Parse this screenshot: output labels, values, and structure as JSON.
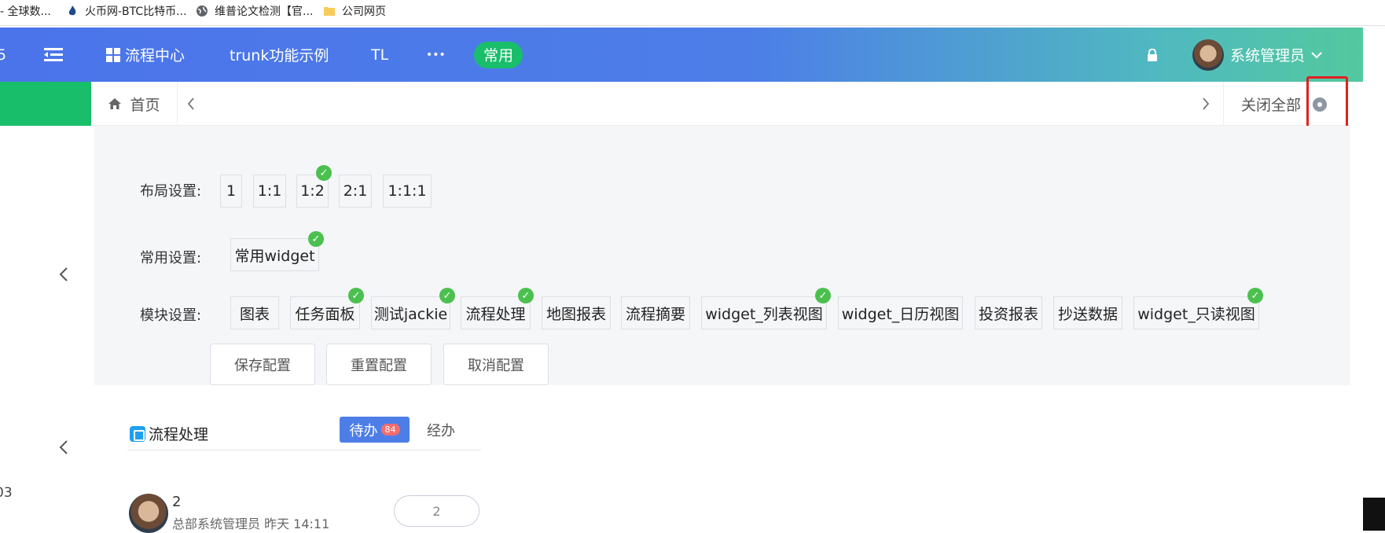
{
  "bookmarks": [
    {
      "label": "- 全球数...",
      "icon": "none"
    },
    {
      "label": "火币网-BTC比特币...",
      "icon": "flame-icon"
    },
    {
      "label": "维普论文检测【官...",
      "icon": "globe-icon"
    },
    {
      "label": "公司网页",
      "icon": "folder-icon"
    }
  ],
  "header": {
    "left_partial": "5",
    "menu": [
      "流程中心",
      "trunk功能示例",
      "TL",
      "•••"
    ],
    "active_pill": "常用",
    "user": "系统管理员"
  },
  "tabs": {
    "home": "首页",
    "close_all": "关闭全部"
  },
  "config": {
    "layout_label": "布局设置:",
    "layout_options": [
      {
        "label": "1",
        "checked": false
      },
      {
        "label": "1:1",
        "checked": false
      },
      {
        "label": "1:2",
        "checked": true
      },
      {
        "label": "2:1",
        "checked": false
      },
      {
        "label": "1:1:1",
        "checked": false
      }
    ],
    "common_label": "常用设置:",
    "common_options": [
      {
        "label": "常用widget",
        "checked": true
      }
    ],
    "module_label": "模块设置:",
    "module_options": [
      {
        "label": "图表",
        "checked": false
      },
      {
        "label": "任务面板",
        "checked": true
      },
      {
        "label": "测试jackie",
        "checked": true
      },
      {
        "label": "流程处理",
        "checked": true
      },
      {
        "label": "地图报表",
        "checked": false
      },
      {
        "label": "流程摘要",
        "checked": false
      },
      {
        "label": "widget_列表视图",
        "checked": true
      },
      {
        "label": "widget_日历视图",
        "checked": false
      },
      {
        "label": "投资报表",
        "checked": false
      },
      {
        "label": "抄送数据",
        "checked": false
      },
      {
        "label": "widget_只读视图",
        "checked": true
      }
    ],
    "buttons": {
      "save": "保存配置",
      "reset": "重置配置",
      "cancel": "取消配置"
    }
  },
  "widget": {
    "title": "流程处理",
    "tab_todo": "待办",
    "todo_count": "84",
    "tab_done": "经办",
    "item": {
      "num": "2",
      "meta": "总部系统管理员 昨天 14:11",
      "action": "2"
    }
  },
  "sidebar": {
    "partial_text": "03"
  },
  "colors": {
    "accent": "#4d7ee8",
    "green": "#19be6b",
    "check": "#4cc04f",
    "highlight_box": "#e02020"
  }
}
